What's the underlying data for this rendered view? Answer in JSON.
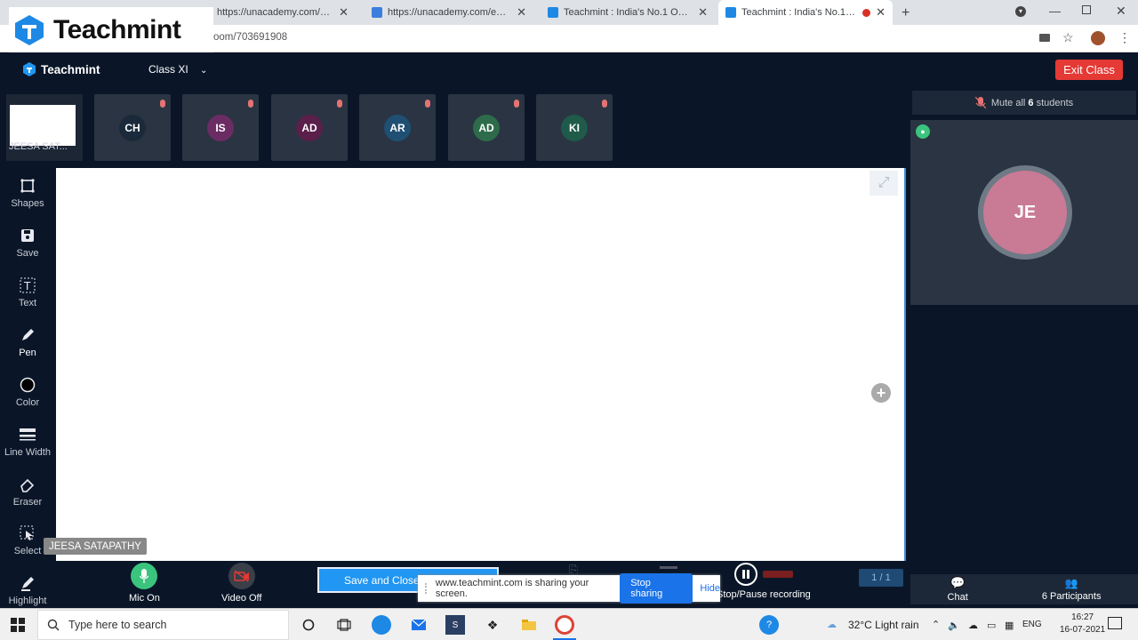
{
  "browser": {
    "tabs": [
      {
        "title": "https://unacademy.com/educato",
        "active": false
      },
      {
        "title": "https://unacademy.com/educato",
        "active": false
      },
      {
        "title": "Teachmint : India's No.1 Online t",
        "active": false
      },
      {
        "title": "Teachmint : India's No.1 Onl",
        "active": true
      }
    ],
    "url": "oom/703691908"
  },
  "watermark": {
    "logo_text": "Teachmint"
  },
  "header": {
    "brand": "Teachmint",
    "class_name": "Class XI",
    "exit_label": "Exit Class"
  },
  "students": {
    "self": {
      "name": "JEESA SAT..."
    },
    "tiles": [
      {
        "initials": "CH",
        "color": "#1b2a3a"
      },
      {
        "initials": "IS",
        "color": "#6b2c64"
      },
      {
        "initials": "AD",
        "color": "#5a1f4a"
      },
      {
        "initials": "AR",
        "color": "#1f4f72"
      },
      {
        "initials": "AD",
        "color": "#2e6b4a"
      },
      {
        "initials": "KI",
        "color": "#1f5a4a"
      }
    ]
  },
  "tools": [
    {
      "label": "Shapes",
      "icon": "shapes-icon"
    },
    {
      "label": "Save",
      "icon": "save-icon"
    },
    {
      "label": "Text",
      "icon": "text-icon"
    },
    {
      "label": "Pen",
      "icon": "pen-icon"
    },
    {
      "label": "Color",
      "icon": "color-icon"
    },
    {
      "label": "Line Width",
      "icon": "line-width-icon"
    },
    {
      "label": "Eraser",
      "icon": "eraser-icon"
    },
    {
      "label": "Select",
      "icon": "select-icon"
    },
    {
      "label": "Highlight",
      "icon": "highlight-icon"
    }
  ],
  "tooltip": "JEESA SATAPATHY",
  "bottom": {
    "mic_label": "Mic On",
    "video_label": "Video Off",
    "save_close": "Save and Close",
    "record_label": "Stop/Pause recording",
    "page_indicator": "1 / 1"
  },
  "share": {
    "message": "www.teachmint.com is sharing your screen.",
    "stop": "Stop sharing",
    "hide": "Hide"
  },
  "right": {
    "mute_prefix": "Mute all",
    "mute_count": "6",
    "mute_suffix": "students",
    "teacher_initials": "JE",
    "chat": "Chat",
    "participants": "6 Participants"
  },
  "taskbar": {
    "search": "Type here to search",
    "weather": "32°C  Light rain",
    "lang": "ENG",
    "time": "16:27",
    "date": "16-07-2021"
  }
}
